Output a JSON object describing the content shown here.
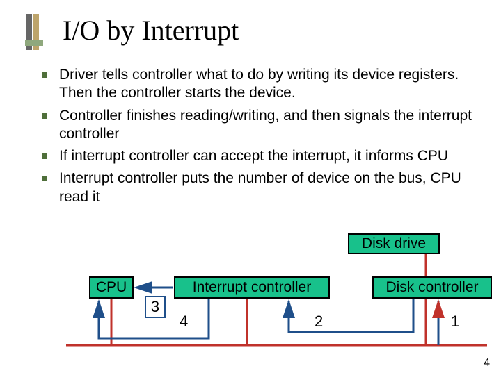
{
  "title": "I/O by Interrupt",
  "bullets": [
    "Driver tells controller what to do by writing its device registers. Then the controller starts the device.",
    "Controller finishes reading/writing, and then signals the interrupt controller",
    "If interrupt controller can accept the interrupt, it informs CPU",
    "Interrupt controller puts the number of device on the bus, CPU read it"
  ],
  "diagram": {
    "disk_drive": "Disk drive",
    "cpu": "CPU",
    "interrupt_controller": "Interrupt controller",
    "disk_controller": "Disk controller",
    "steps": {
      "s1": "1",
      "s2": "2",
      "s3": "3",
      "s4": "4"
    }
  },
  "page_number": "4"
}
